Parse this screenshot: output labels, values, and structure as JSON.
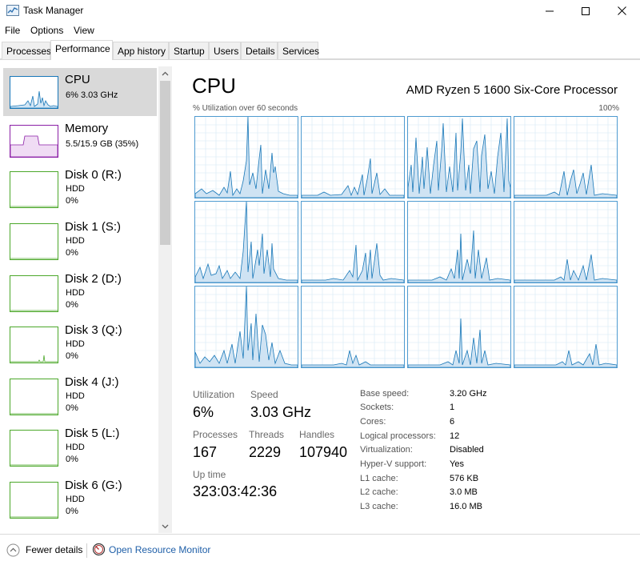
{
  "window": {
    "title": "Task Manager"
  },
  "menu": [
    "File",
    "Options",
    "View"
  ],
  "tabs": [
    "Processes",
    "Performance",
    "App history",
    "Startup",
    "Users",
    "Details",
    "Services"
  ],
  "active_tab": "Performance",
  "sidebar": {
    "items": [
      {
        "title": "CPU",
        "line1": "6%  3.03 GHz",
        "line2": "",
        "selected": true,
        "color": "#1777b8"
      },
      {
        "title": "Memory",
        "line1": "5.5/15.9 GB (35%)",
        "line2": "",
        "selected": false,
        "color": "#8b1fa6"
      },
      {
        "title": "Disk 0 (R:)",
        "line1": "HDD",
        "line2": "0%",
        "selected": false,
        "color": "#4ca82a"
      },
      {
        "title": "Disk 1 (S:)",
        "line1": "HDD",
        "line2": "0%",
        "selected": false,
        "color": "#4ca82a"
      },
      {
        "title": "Disk 2 (D:)",
        "line1": "HDD",
        "line2": "0%",
        "selected": false,
        "color": "#4ca82a"
      },
      {
        "title": "Disk 3 (Q:)",
        "line1": "HDD",
        "line2": "0%",
        "selected": false,
        "color": "#4ca82a"
      },
      {
        "title": "Disk 4 (J:)",
        "line1": "HDD",
        "line2": "0%",
        "selected": false,
        "color": "#4ca82a"
      },
      {
        "title": "Disk 5 (L:)",
        "line1": "HDD",
        "line2": "0%",
        "selected": false,
        "color": "#4ca82a"
      },
      {
        "title": "Disk 6 (G:)",
        "line1": "HDD",
        "line2": "0%",
        "selected": false,
        "color": "#4ca82a"
      }
    ]
  },
  "main": {
    "title": "CPU",
    "cpu_name": "AMD Ryzen 5 1600 Six-Core Processor",
    "graph_caption": "% Utilization over 60 seconds",
    "graph_max": "100%",
    "graph_color": "#1777b8",
    "stats": {
      "utilization_label": "Utilization",
      "utilization_value": "6%",
      "speed_label": "Speed",
      "speed_value": "3.03 GHz",
      "processes_label": "Processes",
      "processes_value": "167",
      "threads_label": "Threads",
      "threads_value": "2229",
      "handles_label": "Handles",
      "handles_value": "107940",
      "uptime_label": "Up time",
      "uptime_value": "323:03:42:36"
    },
    "specs": [
      {
        "label": "Base speed:",
        "value": "3.20 GHz"
      },
      {
        "label": "Sockets:",
        "value": "1"
      },
      {
        "label": "Cores:",
        "value": "6"
      },
      {
        "label": "Logical processors:",
        "value": "12"
      },
      {
        "label": "Virtualization:",
        "value": "Disabled"
      },
      {
        "label": "Hyper-V support:",
        "value": "Yes"
      },
      {
        "label": "L1 cache:",
        "value": "576 KB"
      },
      {
        "label": "L2 cache:",
        "value": "3.0 MB"
      },
      {
        "label": "L3 cache:",
        "value": "16.0 MB"
      }
    ]
  },
  "footer": {
    "fewer_details": "Fewer details",
    "resource_monitor": "Open Resource Monitor"
  }
}
